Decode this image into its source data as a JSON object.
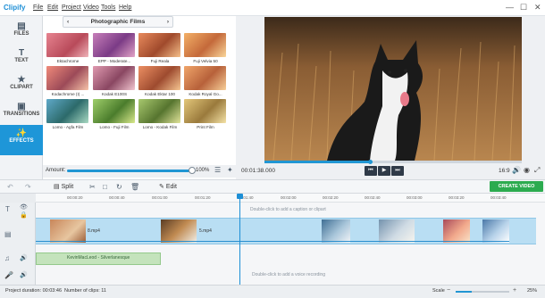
{
  "app": {
    "title": "Clipify",
    "menu": [
      "File",
      "Edit",
      "Project",
      "Video",
      "Tools",
      "Help"
    ],
    "window_controls": [
      "—",
      "☐",
      "✕"
    ]
  },
  "sidebar": {
    "items": [
      {
        "label": "FILES",
        "icon": "files-icon",
        "glyph": "▤"
      },
      {
        "label": "TEXT",
        "icon": "text-icon",
        "glyph": "T"
      },
      {
        "label": "CLIPART",
        "icon": "clipart-icon",
        "glyph": "★"
      },
      {
        "label": "TRANSITIONS",
        "icon": "transitions-icon",
        "glyph": "▣"
      },
      {
        "label": "EFFECTS",
        "icon": "effects-icon",
        "glyph": "✨"
      }
    ],
    "active": "EFFECTS"
  },
  "effects": {
    "category": "Photographic Films",
    "thumbs": [
      {
        "label": "Ektachrome"
      },
      {
        "label": "EPP - Moderate..."
      },
      {
        "label": "Fuji Reala"
      },
      {
        "label": "Fuji Velvia 50"
      },
      {
        "label": "Kodachrome (I) ..."
      },
      {
        "label": "Kodak E100S"
      },
      {
        "label": "Kodak Ektar 100"
      },
      {
        "label": "Kodak Royal Go..."
      },
      {
        "label": "Lomo - Agfa Film"
      },
      {
        "label": "Lomo - Fuji Film"
      },
      {
        "label": "Lomo - Kodak Film"
      },
      {
        "label": "Print Film"
      }
    ],
    "amount_label": "Amount:",
    "amount_value": "100%",
    "amount_fraction": 1.0
  },
  "player": {
    "time": "00:01:38.000",
    "aspect": "16:9",
    "progress_fraction": 0.41
  },
  "timeline_toolbar": {
    "split": "Split",
    "edit": "Edit",
    "create": "CREATE VIDEO"
  },
  "ruler": [
    "00:00:20",
    "00:00:40",
    "00:01:00",
    "00:01:20",
    "00:01:40",
    "00:02:00",
    "00:02:20",
    "00:02:40",
    "00:03:00",
    "00:03:20",
    "00:03:40"
  ],
  "tracks": {
    "caption_hint": "Double-click to add a caption or clipart",
    "voice_hint": "Double-click to add a voice recording",
    "clip1_name": "8.mp4",
    "clip2_name": "5.mp4",
    "audio_name": "KevinMacLeod - Silverlanesque"
  },
  "status": {
    "duration_label": "Project duration:",
    "duration": "00:03:46",
    "clips_label": "Number of clips:",
    "clips": "11",
    "scale_label": "Scale",
    "scale_value": "25%",
    "scale_fraction": 0.3
  }
}
